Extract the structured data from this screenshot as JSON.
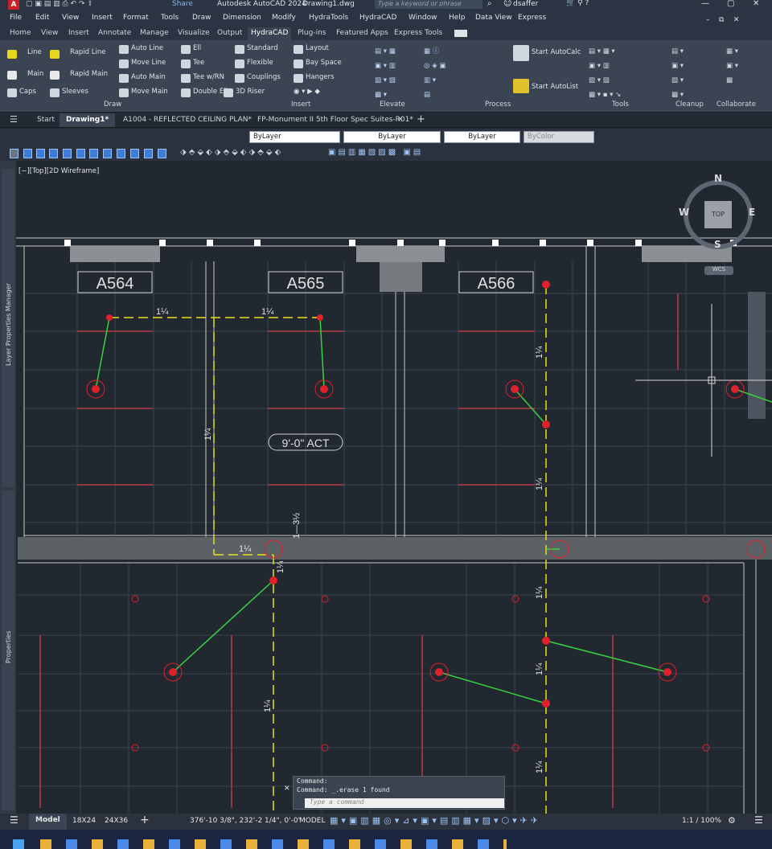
{
  "app": {
    "badge": "A",
    "title": "Autodesk AutoCAD 2024",
    "file": "Drawing1.dwg",
    "share": "Share",
    "search_placeholder": "Type a keyword or phrase",
    "user": "dsaffer"
  },
  "menu": [
    "File",
    "Edit",
    "View",
    "Insert",
    "Format",
    "Tools",
    "Draw",
    "Dimension",
    "Modify",
    "HydraTools",
    "HydraCAD",
    "Window",
    "Help",
    "Data View",
    "Express"
  ],
  "ribbon_tabs": [
    "Home",
    "View",
    "Insert",
    "Annotate",
    "Manage",
    "Visualize",
    "Output",
    "HydraCAD",
    "Plug-ins",
    "Featured Apps",
    "Express Tools"
  ],
  "ribbon_active": "HydraCAD",
  "draw_panel": {
    "title": "Draw",
    "items": [
      "Line",
      "Rapid Line",
      "Main",
      "Rapid Main",
      "Caps",
      "Sleeves"
    ]
  },
  "insert_panel": {
    "title": "Insert",
    "items": [
      "Auto Line",
      "Move Line",
      "Auto Main",
      "Move Main",
      "Ell",
      "Tee",
      "Tee w/RN",
      "Double Ell",
      "Standard",
      "Flexible",
      "Couplings",
      "3D Riser",
      "Layout",
      "Bay Space",
      "Hangers"
    ]
  },
  "elevate_panel": {
    "title": "Elevate"
  },
  "process_panel": {
    "title": "Process",
    "items": [
      "Start AutoCalc",
      "Start AutoList"
    ]
  },
  "tools_panel": {
    "title": "Tools"
  },
  "cleanup_panel": {
    "title": "Cleanup"
  },
  "collab_panel": {
    "title": "Collaborate"
  },
  "file_tabs": [
    "Start",
    "Drawing1*",
    "A1004 - REFLECTED CEILING PLAN*",
    "FP-Monument II 5th Floor Spec Suites-R01*"
  ],
  "properties": {
    "layer": "ByLayer",
    "linetype": "ByLayer",
    "lineweight": "ByLayer",
    "color": "ByColor"
  },
  "viewport": {
    "label": "[−][Top][2D Wireframe]",
    "rooms": [
      "A564",
      "A565",
      "A566"
    ],
    "ceiling_tag": "9'-0\" ACT",
    "pipe_labels": [
      "1¼",
      "1¼",
      "1¼",
      "1¼",
      "1¼",
      "1¼",
      "1¼",
      "1¼",
      "1¼",
      "1¼",
      "1¼"
    ],
    "dim_label": "1—3½",
    "viewcube": {
      "n": "N",
      "s": "S",
      "e": "E",
      "w": "W",
      "top": "TOP",
      "wcs": "WCS"
    }
  },
  "left_palettes": [
    "Layer Properties Manager",
    "Properties"
  ],
  "command": {
    "line1": "Command:",
    "line2": "Command: _.erase 1 found",
    "placeholder": "Type a command"
  },
  "layout_tabs": [
    "Model",
    "18X24",
    "24X36"
  ],
  "status": {
    "coords": "376'-10 3/8\", 232'-2 1/4\", 0'-0\"",
    "model": "MODEL",
    "scale": "1:1 / 100%"
  },
  "colors": {
    "background": "#212830",
    "grid": "#3a4550",
    "pipe": "#e8e01e",
    "branch": "#37d23f",
    "head": "#e0202a",
    "wall": "#c8c8c8",
    "red_line": "#b83a44"
  }
}
